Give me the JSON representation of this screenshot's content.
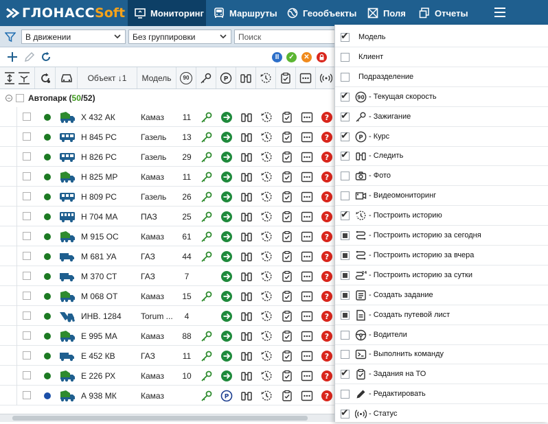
{
  "app": {
    "logo_main": "ГЛОНАСС",
    "logo_soft": "Soft"
  },
  "nav": {
    "tabs": [
      {
        "label": "Мониторинг",
        "icon": "monitor-icon",
        "active": true
      },
      {
        "label": "Маршруты",
        "icon": "bus-icon",
        "active": false
      },
      {
        "label": "Геообъекты",
        "icon": "globe-icon",
        "active": false
      },
      {
        "label": "Поля",
        "icon": "field-icon",
        "active": false
      },
      {
        "label": "Отчеты",
        "icon": "reports-icon",
        "active": false
      }
    ]
  },
  "filters": {
    "status": "В движении",
    "grouping": "Без группировки",
    "search_placeholder": "Поиск"
  },
  "table": {
    "headers": {
      "object": "Объект ↓1",
      "model": "Модель",
      "speed_icon_text": "90"
    },
    "group": {
      "name": "Автопарк",
      "count_active": "50",
      "count_total": "52",
      "open": "(",
      "sep": "/",
      "close": ")"
    },
    "rows": [
      {
        "name": "Х 432 АК",
        "model": "Камаз",
        "speed": "11",
        "vehicle": "dump",
        "dot": "#1d7a23",
        "key": true,
        "dir": "arrow",
        "task": true
      },
      {
        "name": "Н 845 РС",
        "model": "Газель",
        "speed": "13",
        "vehicle": "bus",
        "dot": "#1d7a23",
        "key": true,
        "dir": "arrow",
        "task": true
      },
      {
        "name": "Н 826 РС",
        "model": "Газель",
        "speed": "29",
        "vehicle": "bus",
        "dot": "#1d7a23",
        "key": true,
        "dir": "arrow",
        "task": true
      },
      {
        "name": "Н 825 МР",
        "model": "Камаз",
        "speed": "11",
        "vehicle": "dump",
        "dot": "#1d7a23",
        "key": true,
        "dir": "arrow",
        "task": true
      },
      {
        "name": "Н 809 РС",
        "model": "Газель",
        "speed": "26",
        "vehicle": "bus",
        "dot": "#1d7a23",
        "key": true,
        "dir": "arrow",
        "task": true
      },
      {
        "name": "Н 704 МА",
        "model": "ПАЗ",
        "speed": "25",
        "vehicle": "bigbus",
        "dot": "#1d7a23",
        "key": true,
        "dir": "arrow",
        "task": true
      },
      {
        "name": "М 915 ОС",
        "model": "Камаз",
        "speed": "61",
        "vehicle": "dump",
        "dot": "#1d7a23",
        "key": true,
        "dir": "arrow",
        "task": true
      },
      {
        "name": "М 681 УА",
        "model": "ГАЗ",
        "speed": "44",
        "vehicle": "truck",
        "dot": "#1d7a23",
        "key": true,
        "dir": "arrow",
        "task": true
      },
      {
        "name": "М 370 СТ",
        "model": "ГАЗ",
        "speed": "7",
        "vehicle": "truck",
        "dot": "#1d7a23",
        "key": false,
        "dir": "arrow",
        "task": true
      },
      {
        "name": "М 068 ОТ",
        "model": "Камаз",
        "speed": "15",
        "vehicle": "dump",
        "dot": "#1d7a23",
        "key": true,
        "dir": "arrow",
        "task": true
      },
      {
        "name": "ИНВ. 1284",
        "model": "Torum ...",
        "speed": "4",
        "vehicle": "harvester",
        "dot": "#1d7a23",
        "key": false,
        "dir": "arrow",
        "task": true
      },
      {
        "name": "Е 995 МА",
        "model": "Камаз",
        "speed": "88",
        "vehicle": "dump",
        "dot": "#1d7a23",
        "key": true,
        "dir": "arrow",
        "task": true
      },
      {
        "name": "Е 452 КВ",
        "model": "ГАЗ",
        "speed": "11",
        "vehicle": "truck",
        "dot": "#1d7a23",
        "key": true,
        "dir": "arrow",
        "task": true
      },
      {
        "name": "Е 226 РХ",
        "model": "Камаз",
        "speed": "10",
        "vehicle": "dump",
        "dot": "#1d7a23",
        "key": true,
        "dir": "arrow",
        "task": true
      },
      {
        "name": "А 938 МК",
        "model": "Камаз",
        "speed": "",
        "vehicle": "dump",
        "dot": "#1b4fa8",
        "key": true,
        "dir": "parking",
        "task": true
      }
    ]
  },
  "column_menu": {
    "items": [
      {
        "label": "Модель",
        "state": "checked",
        "icon": ""
      },
      {
        "label": "Клиент",
        "state": "unchecked",
        "icon": ""
      },
      {
        "label": "Подразделение",
        "state": "unchecked",
        "icon": ""
      },
      {
        "label": "Текущая скорость",
        "state": "checked",
        "icon": "speed-90-icon"
      },
      {
        "label": "Зажигание",
        "state": "checked",
        "icon": "key-icon"
      },
      {
        "label": "Курс",
        "state": "checked",
        "icon": "parking-icon"
      },
      {
        "label": "Следить",
        "state": "checked",
        "icon": "binoculars-icon"
      },
      {
        "label": "Фото",
        "state": "unchecked",
        "icon": "camera-icon"
      },
      {
        "label": "Видеомониторинг",
        "state": "unchecked",
        "icon": "video-icon"
      },
      {
        "label": "Построить историю",
        "state": "checked",
        "icon": "history-icon"
      },
      {
        "label": "Построить историю за сегодня",
        "state": "partial",
        "icon": "route-icon"
      },
      {
        "label": "Построить историю за вчера",
        "state": "partial",
        "icon": "route-icon"
      },
      {
        "label": "Построить историю за сутки",
        "state": "partial",
        "icon": "route-24-icon"
      },
      {
        "label": "Создать задание",
        "state": "partial",
        "icon": "task-list-icon"
      },
      {
        "label": "Создать путевой лист",
        "state": "partial",
        "icon": "waybill-icon"
      },
      {
        "label": "Водители",
        "state": "unchecked",
        "icon": "steering-wheel-icon"
      },
      {
        "label": "Выполнить команду",
        "state": "unchecked",
        "icon": "terminal-icon"
      },
      {
        "label": "Задания на ТО",
        "state": "checked",
        "icon": "clipboard-check-icon"
      },
      {
        "label": "Редактировать",
        "state": "unchecked",
        "icon": "pencil-icon"
      },
      {
        "label": "Статус",
        "state": "checked",
        "icon": "signal-icon"
      }
    ]
  },
  "colors": {
    "nav": "#1f5f8f",
    "accent_green": "#2e8b2e",
    "status_red": "#d9261c"
  }
}
